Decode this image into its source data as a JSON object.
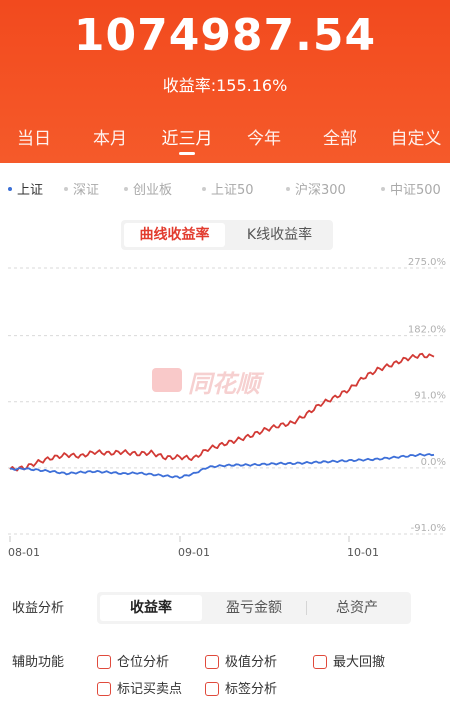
{
  "header": {
    "total_value": "1074987.54",
    "yield_label": "收益率:",
    "yield_value": "155.16%"
  },
  "period_tabs": [
    {
      "label": "当日",
      "active": false
    },
    {
      "label": "本月",
      "active": false
    },
    {
      "label": "近三月",
      "active": true
    },
    {
      "label": "今年",
      "active": false
    },
    {
      "label": "全部",
      "active": false
    },
    {
      "label": "自定义",
      "active": false
    }
  ],
  "index_tabs": [
    {
      "label": "上证",
      "active": true
    },
    {
      "label": "深证",
      "active": false
    },
    {
      "label": "创业板",
      "active": false
    },
    {
      "label": "上证50",
      "active": false
    },
    {
      "label": "沪深300",
      "active": false
    },
    {
      "label": "中证500",
      "active": false
    }
  ],
  "chart_toggle": {
    "active_label": "曲线收益率",
    "other_label": "K线收益率"
  },
  "watermark_text": "同花顺",
  "chart_data": {
    "type": "line",
    "y_ticks": [
      "275.0%",
      "182.0%",
      "91.0%",
      "0.0%",
      "-91.0%"
    ],
    "y_tick_values": [
      275.0,
      182.0,
      91.0,
      0.0,
      -91.0
    ],
    "ylim": [
      -91.0,
      275.0
    ],
    "x_tick_labels": [
      "08-01",
      "09-01",
      "10-01"
    ],
    "x": [
      "07-28",
      "07-31",
      "08-03",
      "08-06",
      "08-09",
      "08-12",
      "08-15",
      "08-18",
      "08-21",
      "08-24",
      "08-27",
      "08-30",
      "09-02",
      "09-05",
      "09-08",
      "09-11",
      "09-14",
      "09-17",
      "09-20",
      "09-23",
      "09-26",
      "09-29",
      "10-02",
      "10-05",
      "10-08",
      "10-11",
      "10-14",
      "10-17",
      "10-20",
      "10-23",
      "10-26"
    ],
    "series": [
      {
        "color": "#d23a35",
        "values": [
          -2,
          0,
          8,
          14,
          18,
          16,
          22,
          20,
          22,
          19,
          21,
          14,
          15,
          13,
          26,
          32,
          38,
          44,
          52,
          58,
          62,
          74,
          88,
          97,
          108,
          124,
          135,
          142,
          150,
          155,
          153
        ]
      },
      {
        "color": "#3d6fd8",
        "values": [
          -2,
          -1,
          -3,
          -5,
          -8,
          -6,
          -5,
          -6,
          -8,
          -7,
          -9,
          -11,
          -13,
          -8,
          1,
          3,
          4,
          4,
          5,
          6,
          6,
          7,
          8,
          9,
          10,
          11,
          12,
          14,
          16,
          18,
          18
        ]
      }
    ]
  },
  "analysis": {
    "label": "收益分析",
    "tabs": [
      {
        "label": "收益率",
        "active": true
      },
      {
        "label": "盈亏金额",
        "active": false
      },
      {
        "label": "总资产",
        "active": false
      }
    ]
  },
  "aux": {
    "label": "辅助功能",
    "checks": [
      {
        "label": "仓位分析"
      },
      {
        "label": "极值分析"
      },
      {
        "label": "最大回撤"
      },
      {
        "label": "标记买卖点"
      },
      {
        "label": "标签分析"
      }
    ]
  },
  "colors": {
    "header_bg": "#f24a1e",
    "accent_red": "#e23b2e",
    "index_blue": "#3b6fd6"
  }
}
